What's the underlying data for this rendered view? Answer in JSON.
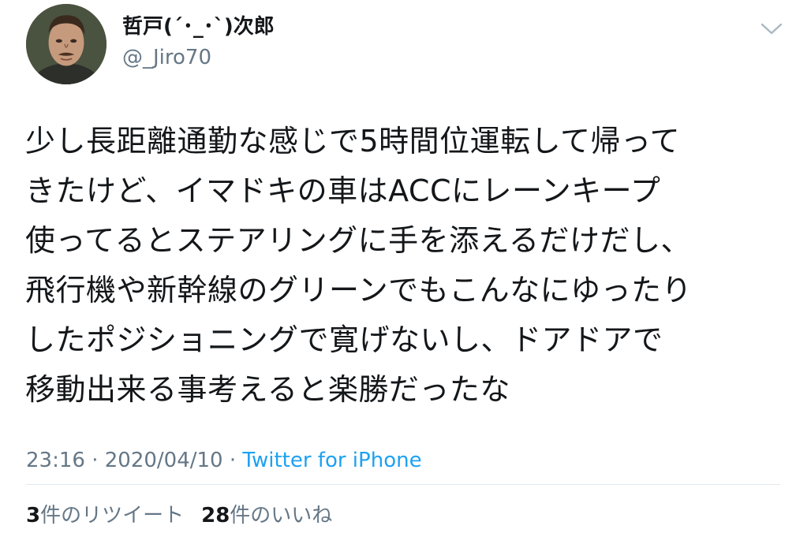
{
  "user": {
    "display_name": "哲戸(´･_･`)次郎",
    "handle": "@_Jiro70",
    "avatar_icon": "portrait-photo"
  },
  "menu_icon": "chevron-down-icon",
  "tweet": {
    "text": "少し長距離通勤な感じで5時間位運転して帰って\nきたけど、イマドキの車はACCにレーンキープ\n使ってるとステアリングに手を添えるだけだし、\n飛行機や新幹線のグリーンでもこんなにゆったり\nしたポジショニングで寛げないし、ドアドアで\n移動出来る事考えると楽勝だったな"
  },
  "meta": {
    "time": "23:16",
    "sep1": " · ",
    "date": "2020/04/10",
    "sep2": " · ",
    "source": "Twitter for iPhone"
  },
  "stats": {
    "retweet_count": "3",
    "retweet_label": "件のリツイート",
    "like_count": "28",
    "like_label": "件のいいね"
  },
  "colors": {
    "text": "#14171a",
    "secondary": "#657786",
    "link": "#1da1f2",
    "divider": "#e1e8ed"
  }
}
